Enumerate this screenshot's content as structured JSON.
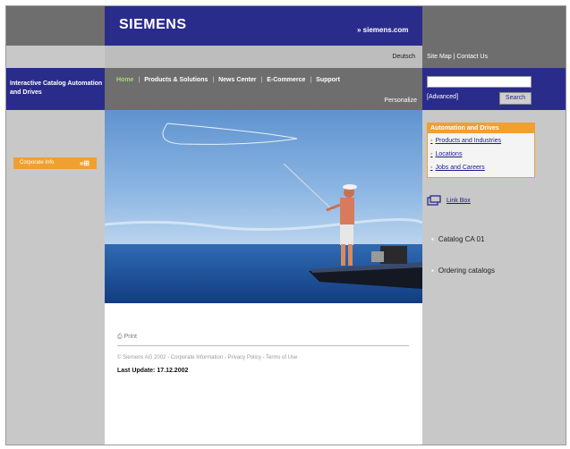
{
  "header": {
    "logo": "SIEMENS",
    "site_link": "» siemens.com",
    "language": "Deutsch",
    "site_map": "Site Map",
    "contact_us": "Contact Us",
    "link_separator": "|"
  },
  "catalog_title": "Interactive Catalog Automation and Drives",
  "nav": {
    "items": [
      "Home",
      "Products & Solutions",
      "News Center",
      "E-Commerce",
      "Support"
    ],
    "separator": "|",
    "personalize": "Personalize"
  },
  "search": {
    "value": "",
    "advanced": "[Advanced]",
    "button": "Search"
  },
  "left": {
    "corporate_info": "Corporate Info",
    "corporate_icon": "»⊞"
  },
  "content": {
    "print_icon": "⎙",
    "print": "Print",
    "footer_links": "© Siemens AG 2002 - Corporate Information - Privacy Policy - Terms of Use",
    "last_update": "Last Update: 17.12.2002"
  },
  "right": {
    "box_title": "Automation and Drives",
    "box_items": [
      "Products and Industries",
      "Locations",
      "Jobs and Careers"
    ],
    "link_box": "Link Box",
    "catalogs": [
      "Catalog CA 01",
      "Ordering catalogs"
    ]
  },
  "colors": {
    "brand_blue": "#2a2c8c",
    "accent_orange": "#f0a030",
    "gray_bar": "#6e6e6e",
    "home_green": "#a8d97a"
  }
}
